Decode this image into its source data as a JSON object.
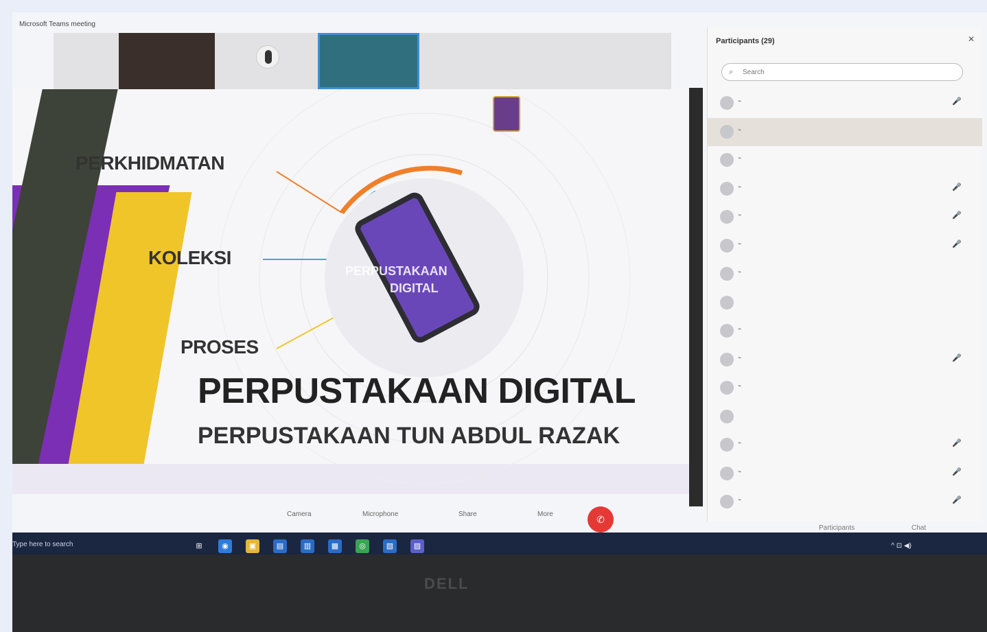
{
  "meeting": {
    "title": "Microsoft Teams meeting",
    "tip": ""
  },
  "video_strip": {
    "tiles": [
      {
        "name": "",
        "id": "tile-1"
      },
      {
        "name": "",
        "id": "tile-2"
      },
      {
        "name": "",
        "id": "tile-3"
      },
      {
        "name": "",
        "id": "tile-4"
      },
      {
        "name": "",
        "id": "tile-5"
      }
    ]
  },
  "slide": {
    "labels": {
      "perkhidmatan": "PERKHIDMATAN",
      "koleksi": "KOLEKSI",
      "proses": "PROSES"
    },
    "circle_text_1": "PERPUSTAKAAN",
    "circle_text_2": "DIGITAL",
    "title": "PERPUSTAKAAN DIGITAL",
    "subtitle": "PERPUSTAKAAN TUN ABDUL RAZAK",
    "logo_text": "",
    "footer": ""
  },
  "participants_panel": {
    "title": "Participants (29)",
    "close_glyph": "✕",
    "search_placeholder": "Search",
    "search_icon_glyph": "⌕",
    "people": [
      {
        "initials": "",
        "name": "",
        "status": "🎤",
        "highlight": false
      },
      {
        "initials": "",
        "name": "",
        "status": "",
        "highlight": true
      },
      {
        "initials": "",
        "name": "",
        "status": "",
        "highlight": false
      },
      {
        "initials": "",
        "name": "",
        "status": "🎤",
        "highlight": false
      },
      {
        "initials": "",
        "name": "",
        "status": "🎤",
        "highlight": false
      },
      {
        "initials": "",
        "name": "",
        "status": "🎤",
        "highlight": false
      },
      {
        "initials": "",
        "name": "",
        "status": "",
        "highlight": false
      },
      {
        "initials": "",
        "name": "",
        "status": "",
        "highlight": false
      },
      {
        "initials": "",
        "name": "",
        "status": "",
        "highlight": false
      },
      {
        "initials": "",
        "name": "",
        "status": "🎤",
        "highlight": false
      },
      {
        "initials": "",
        "name": "",
        "status": "",
        "highlight": false
      },
      {
        "initials": "",
        "name": "",
        "status": "",
        "highlight": false
      },
      {
        "initials": "",
        "name": "",
        "status": "🎤",
        "highlight": false
      },
      {
        "initials": "",
        "name": "",
        "status": "🎤",
        "highlight": false
      },
      {
        "initials": "",
        "name": "",
        "status": "🎤",
        "highlight": false
      }
    ]
  },
  "controls": {
    "items": [
      {
        "label": "Camera",
        "id": "camera"
      },
      {
        "label": "Microphone",
        "id": "microphone"
      },
      {
        "label": "Share",
        "id": "share"
      },
      {
        "label": "More",
        "id": "more"
      }
    ],
    "leave_glyph": "✆",
    "participants_label": "Participants",
    "chat_label": "Chat"
  },
  "taskbar": {
    "search_text": "Type here to search",
    "icons": [
      "⊞",
      "◉",
      "▣",
      "▤",
      "▥",
      "▦",
      "◎",
      "▧",
      "▨"
    ],
    "tray": "^ ⊡ ◀)",
    "time": "",
    "date": ""
  },
  "monitor": {
    "brand": "DELL"
  },
  "colors": {
    "accent": "#3f8fd8",
    "leave": "#e53935",
    "taskbar": "#1b2640",
    "slide_purple": "#7b2fb5",
    "slide_yellow": "#f0c52a"
  }
}
